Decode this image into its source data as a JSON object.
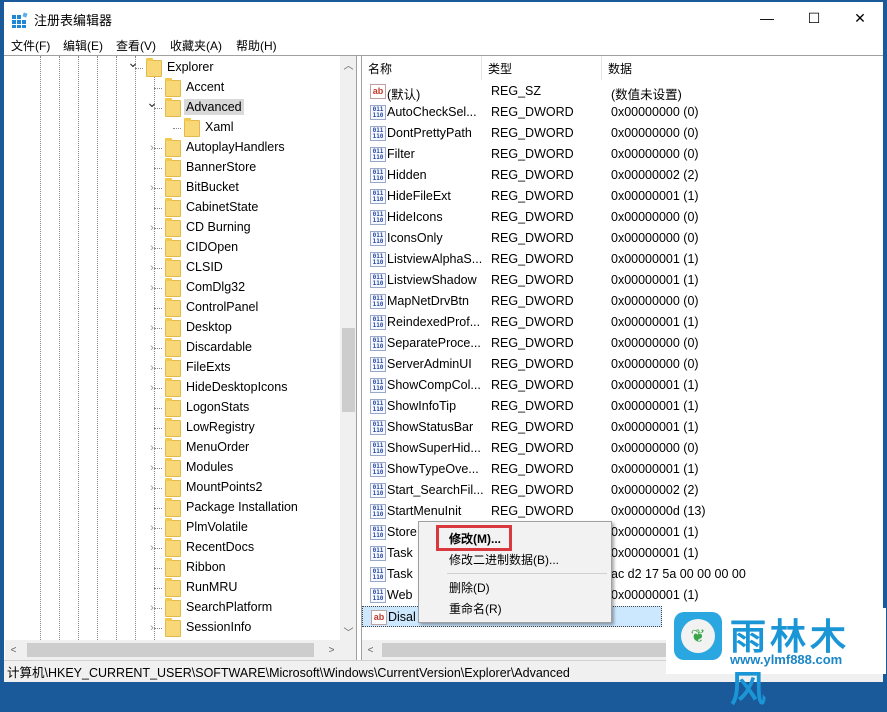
{
  "window": {
    "title": "注册表编辑器",
    "controls": {
      "minimize": "—",
      "maximize": "☐",
      "close": "✕"
    }
  },
  "menubar": [
    {
      "label": "文件(F)"
    },
    {
      "label": "编辑(E)"
    },
    {
      "label": "查看(V)"
    },
    {
      "label": "收藏夹(A)"
    },
    {
      "label": "帮助(H)"
    }
  ],
  "tree": {
    "items": [
      {
        "label": "Explorer",
        "level": 0,
        "expander": "expanded"
      },
      {
        "label": "Accent",
        "level": 1,
        "expander": "none"
      },
      {
        "label": "Advanced",
        "level": 1,
        "expander": "expanded",
        "selected": true
      },
      {
        "label": "Xaml",
        "level": 2,
        "expander": "none"
      },
      {
        "label": "AutoplayHandlers",
        "level": 1,
        "expander": "collapsed"
      },
      {
        "label": "BannerStore",
        "level": 1,
        "expander": "none"
      },
      {
        "label": "BitBucket",
        "level": 1,
        "expander": "collapsed"
      },
      {
        "label": "CabinetState",
        "level": 1,
        "expander": "none"
      },
      {
        "label": "CD Burning",
        "level": 1,
        "expander": "collapsed"
      },
      {
        "label": "CIDOpen",
        "level": 1,
        "expander": "collapsed"
      },
      {
        "label": "CLSID",
        "level": 1,
        "expander": "collapsed"
      },
      {
        "label": "ComDlg32",
        "level": 1,
        "expander": "collapsed"
      },
      {
        "label": "ControlPanel",
        "level": 1,
        "expander": "none"
      },
      {
        "label": "Desktop",
        "level": 1,
        "expander": "collapsed"
      },
      {
        "label": "Discardable",
        "level": 1,
        "expander": "collapsed"
      },
      {
        "label": "FileExts",
        "level": 1,
        "expander": "collapsed"
      },
      {
        "label": "HideDesktopIcons",
        "level": 1,
        "expander": "collapsed"
      },
      {
        "label": "LogonStats",
        "level": 1,
        "expander": "none"
      },
      {
        "label": "LowRegistry",
        "level": 1,
        "expander": "none"
      },
      {
        "label": "MenuOrder",
        "level": 1,
        "expander": "collapsed"
      },
      {
        "label": "Modules",
        "level": 1,
        "expander": "collapsed"
      },
      {
        "label": "MountPoints2",
        "level": 1,
        "expander": "collapsed"
      },
      {
        "label": "Package Installation",
        "level": 1,
        "expander": "none"
      },
      {
        "label": "PlmVolatile",
        "level": 1,
        "expander": "collapsed"
      },
      {
        "label": "RecentDocs",
        "level": 1,
        "expander": "collapsed"
      },
      {
        "label": "Ribbon",
        "level": 1,
        "expander": "none"
      },
      {
        "label": "RunMRU",
        "level": 1,
        "expander": "none"
      },
      {
        "label": "SearchPlatform",
        "level": 1,
        "expander": "collapsed"
      },
      {
        "label": "SessionInfo",
        "level": 1,
        "expander": "collapsed"
      }
    ]
  },
  "list": {
    "columns": [
      "名称",
      "类型",
      "数据"
    ],
    "rows": [
      {
        "icon": "ab",
        "name": "(默认)",
        "type": "REG_SZ",
        "data": "(数值未设置)"
      },
      {
        "icon": "dword",
        "name": "AutoCheckSel...",
        "type": "REG_DWORD",
        "data": "0x00000000 (0)"
      },
      {
        "icon": "dword",
        "name": "DontPrettyPath",
        "type": "REG_DWORD",
        "data": "0x00000000 (0)"
      },
      {
        "icon": "dword",
        "name": "Filter",
        "type": "REG_DWORD",
        "data": "0x00000000 (0)"
      },
      {
        "icon": "dword",
        "name": "Hidden",
        "type": "REG_DWORD",
        "data": "0x00000002 (2)"
      },
      {
        "icon": "dword",
        "name": "HideFileExt",
        "type": "REG_DWORD",
        "data": "0x00000001 (1)"
      },
      {
        "icon": "dword",
        "name": "HideIcons",
        "type": "REG_DWORD",
        "data": "0x00000000 (0)"
      },
      {
        "icon": "dword",
        "name": "IconsOnly",
        "type": "REG_DWORD",
        "data": "0x00000000 (0)"
      },
      {
        "icon": "dword",
        "name": "ListviewAlphaS...",
        "type": "REG_DWORD",
        "data": "0x00000001 (1)"
      },
      {
        "icon": "dword",
        "name": "ListviewShadow",
        "type": "REG_DWORD",
        "data": "0x00000001 (1)"
      },
      {
        "icon": "dword",
        "name": "MapNetDrvBtn",
        "type": "REG_DWORD",
        "data": "0x00000000 (0)"
      },
      {
        "icon": "dword",
        "name": "ReindexedProf...",
        "type": "REG_DWORD",
        "data": "0x00000001 (1)"
      },
      {
        "icon": "dword",
        "name": "SeparateProce...",
        "type": "REG_DWORD",
        "data": "0x00000000 (0)"
      },
      {
        "icon": "dword",
        "name": "ServerAdminUI",
        "type": "REG_DWORD",
        "data": "0x00000000 (0)"
      },
      {
        "icon": "dword",
        "name": "ShowCompCol...",
        "type": "REG_DWORD",
        "data": "0x00000001 (1)"
      },
      {
        "icon": "dword",
        "name": "ShowInfoTip",
        "type": "REG_DWORD",
        "data": "0x00000001 (1)"
      },
      {
        "icon": "dword",
        "name": "ShowStatusBar",
        "type": "REG_DWORD",
        "data": "0x00000001 (1)"
      },
      {
        "icon": "dword",
        "name": "ShowSuperHid...",
        "type": "REG_DWORD",
        "data": "0x00000000 (0)"
      },
      {
        "icon": "dword",
        "name": "ShowTypeOve...",
        "type": "REG_DWORD",
        "data": "0x00000001 (1)"
      },
      {
        "icon": "dword",
        "name": "Start_SearchFil...",
        "type": "REG_DWORD",
        "data": "0x00000002 (2)"
      },
      {
        "icon": "dword",
        "name": "StartMenuInit",
        "type": "REG_DWORD",
        "data": "0x0000000d (13)"
      },
      {
        "icon": "dword",
        "name": "Store",
        "type": "",
        "data": "0x00000001 (1)"
      },
      {
        "icon": "dword",
        "name": "Task",
        "type": "",
        "data": "0x00000001 (1)"
      },
      {
        "icon": "dword",
        "name": "Task",
        "type": "",
        "data": "ac d2 17 5a 00 00 00 00"
      },
      {
        "icon": "dword",
        "name": "Web",
        "type": "",
        "data": "0x00000001 (1)"
      },
      {
        "icon": "ab",
        "name": "Disal",
        "type": "",
        "data": "",
        "focused": true
      }
    ]
  },
  "context_menu": {
    "items": [
      {
        "label": "修改(M)...",
        "bold": true,
        "highlighted": true
      },
      {
        "label": "修改二进制数据(B)..."
      },
      {
        "separator": true
      },
      {
        "label": "删除(D)"
      },
      {
        "label": "重命名(R)"
      }
    ],
    "highlight_color": "#d9383e"
  },
  "statusbar": {
    "path": "计算机\\HKEY_CURRENT_USER\\SOFTWARE\\Microsoft\\Windows\\CurrentVersion\\Explorer\\Advanced"
  },
  "watermark": {
    "title": "雨林木风",
    "url": "www.ylmf888.com"
  },
  "colors": {
    "accent_border": "#1a5a9a",
    "focused_row": "#cce8ff",
    "selected_tree": "#d9d9d9",
    "folder": "#f8d876"
  }
}
